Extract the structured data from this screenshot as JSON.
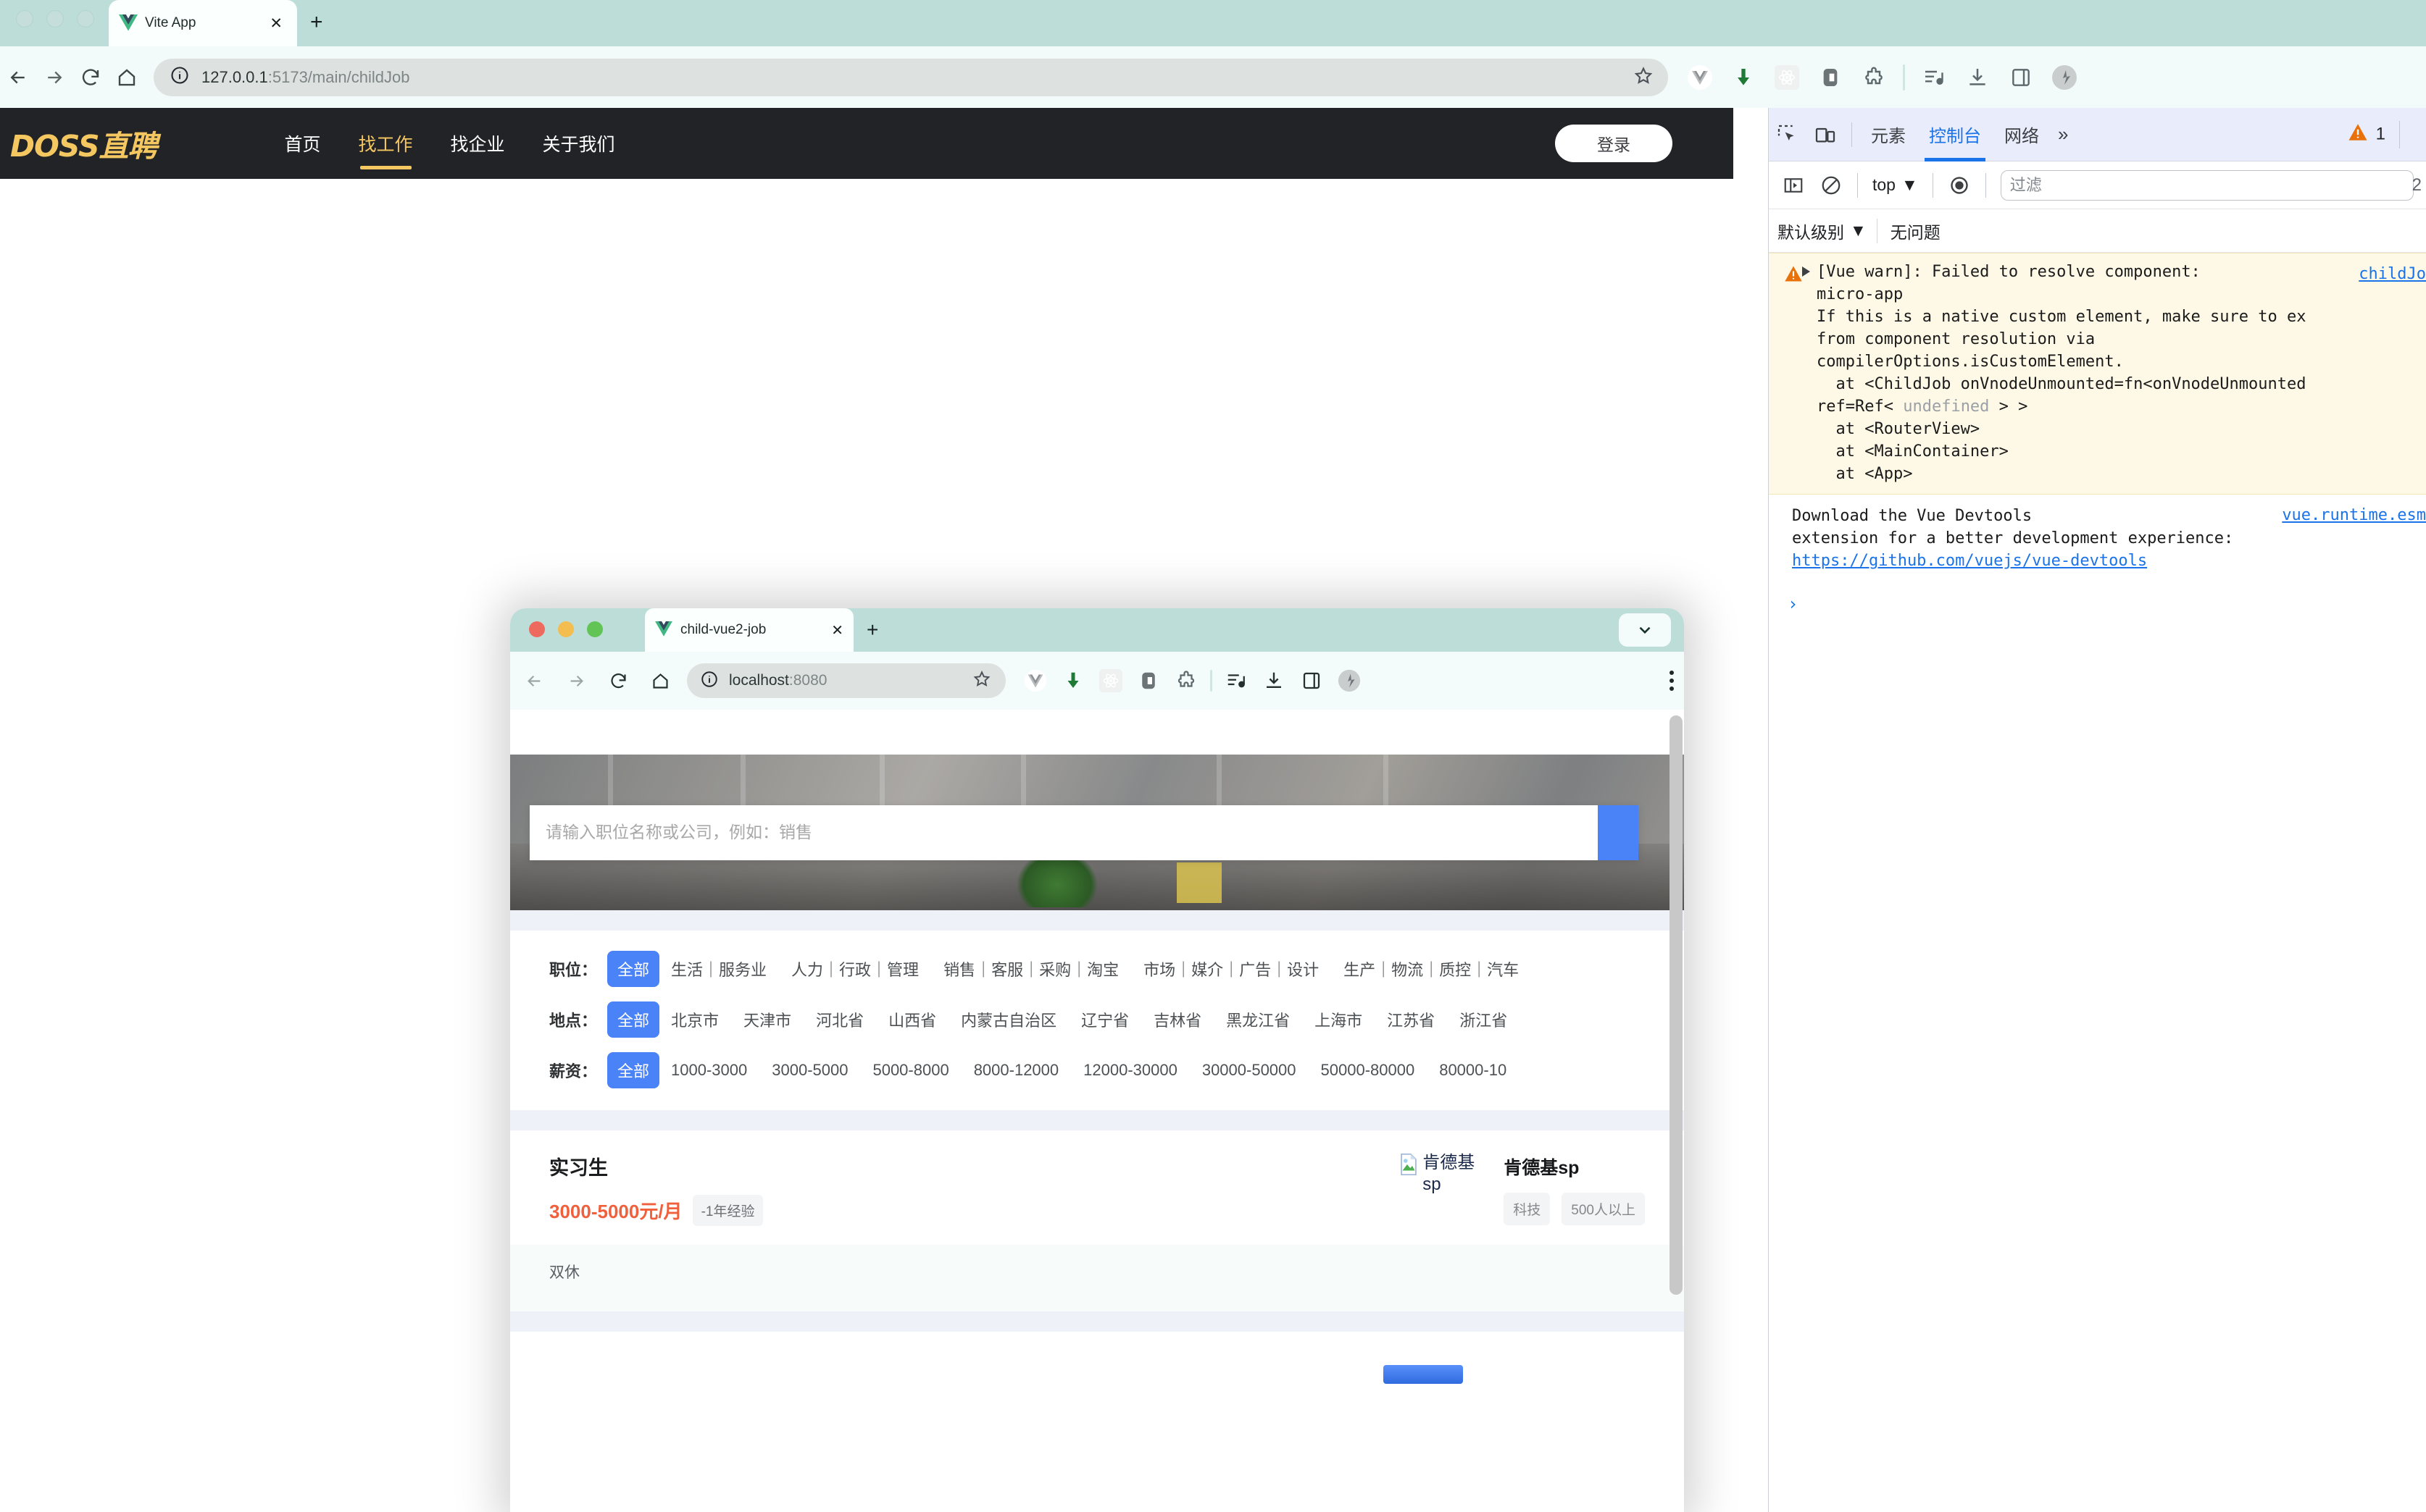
{
  "outer_browser": {
    "tab": {
      "title": "Vite App",
      "favicon": "vue-logo-icon",
      "close": "✕"
    },
    "new_tab": "+",
    "nav": {
      "back": "back-icon",
      "forward": "forward-icon",
      "reload": "reload-icon",
      "home": "home-icon"
    },
    "omnibox": {
      "site_info": "info-icon",
      "url_main": "127.0.0.1",
      "url_rest": ":5173/main/childJob",
      "bookmark": "star-icon"
    },
    "extensions": [
      "vue-devtools-icon",
      "download-arrow-icon",
      "react-devtools-icon",
      "clipboard-icon",
      "puzzle-extension-icon",
      "playlist-icon",
      "downloads-icon",
      "side-panel-icon",
      "profile-avatar-icon"
    ]
  },
  "doss_page": {
    "logo": "DOSS直聘",
    "menu": [
      {
        "label": "首页",
        "active": false
      },
      {
        "label": "找工作",
        "active": true
      },
      {
        "label": "找企业",
        "active": false
      },
      {
        "label": "关于我们",
        "active": false
      }
    ],
    "login_label": "登录",
    "accent_color": "#f5c761",
    "nav_bg": "#222327"
  },
  "child_window": {
    "tab": {
      "title": "child-vue2-job",
      "favicon": "vue-logo-icon",
      "close": "✕"
    },
    "new_tab": "+",
    "tab_list_chevron": "chevron-down-icon",
    "traffic_lights": [
      "#ee6a5f",
      "#f4bd4f",
      "#61c454"
    ],
    "omnibox": {
      "url_main": "localhost",
      "url_rest": ":8080",
      "bookmark": "star-icon"
    },
    "extensions": [
      "vue-devtools-icon",
      "download-arrow-icon",
      "react-devtools-icon",
      "clipboard-icon",
      "puzzle-extension-icon",
      "playlist-icon",
      "downloads-icon",
      "side-panel-icon",
      "profile-avatar-icon"
    ],
    "kebab": "more-menu-icon",
    "hero": {
      "search_placeholder": "请输入职位名称或公司，例如：销售",
      "search_value": "",
      "search_button_color": "#4a82f7"
    },
    "filters": [
      {
        "label": "职位：",
        "all_label": "全部",
        "options": [
          "生活｜服务业",
          "人力｜行政｜管理",
          "销售｜客服｜采购｜淘宝",
          "市场｜媒介｜广告｜设计",
          "生产｜物流｜质控｜汽车"
        ]
      },
      {
        "label": "地点：",
        "all_label": "全部",
        "options": [
          "北京市",
          "天津市",
          "河北省",
          "山西省",
          "内蒙古自治区",
          "辽宁省",
          "吉林省",
          "黑龙江省",
          "上海市",
          "江苏省",
          "浙江省"
        ]
      },
      {
        "label": "薪资：",
        "all_label": "全部",
        "options": [
          "1000-3000",
          "3000-5000",
          "5000-8000",
          "8000-12000",
          "12000-30000",
          "30000-50000",
          "50000-80000",
          "80000-10"
        ]
      }
    ],
    "job_card": {
      "title": "实习生",
      "salary": "3000-5000元/月",
      "experience": "-1年经验",
      "broken_image_alt": "肯德基sp",
      "company_name": "肯德基sp",
      "company_tags": [
        "科技",
        "500人以上"
      ],
      "welfare": "双休",
      "salary_color": "#f1603d"
    }
  },
  "devtools": {
    "header": {
      "inspect_icon": "inspect-element-icon",
      "device_icon": "device-toolbar-icon",
      "tabs": [
        {
          "label": "元素",
          "active": false
        },
        {
          "label": "控制台",
          "active": true
        },
        {
          "label": "网络",
          "active": false
        }
      ],
      "more_tabs": "»",
      "warning_icon": "warning-triangle-icon",
      "warning_count": "1"
    },
    "toolbar": {
      "sidebar_icon": "show-console-sidebar-icon",
      "clear_icon": "clear-console-icon",
      "context": "top",
      "context_caret": "chevron-down-icon",
      "eye_icon": "live-expression-icon",
      "filter_placeholder": "过滤",
      "filter_value": "",
      "hidden_count": "2"
    },
    "levels": {
      "level_label": "默认级别",
      "level_caret": "chevron-down-icon",
      "issues_label": "无问题"
    },
    "console": {
      "warning": {
        "icon": "warning-triangle-icon",
        "expander": "expand-triangle-icon",
        "line1": "[Vue warn]: Failed to resolve component:",
        "line2": "micro-app",
        "line3": "If this is a native custom element, make sure to ex",
        "line4": "from component resolution via",
        "line5": "compilerOptions.isCustomElement.",
        "line6": "  at <ChildJob onVnodeUnmounted=fn<onVnodeUnmounted",
        "line7_a": "ref=Ref< ",
        "line7_b": "undefined",
        "line7_c": " > >",
        "line8": "  at <RouterView>",
        "line9": "  at <MainContainer>",
        "line10": "  at <App>",
        "source_link": "childJo"
      },
      "devtools_message": {
        "line1": "Download the Vue Devtools",
        "line2": "extension for a better development experience:",
        "url": "https://github.com/vuejs/vue-devtools",
        "source_link": "vue.runtime.esm"
      },
      "prompt": "›"
    }
  }
}
